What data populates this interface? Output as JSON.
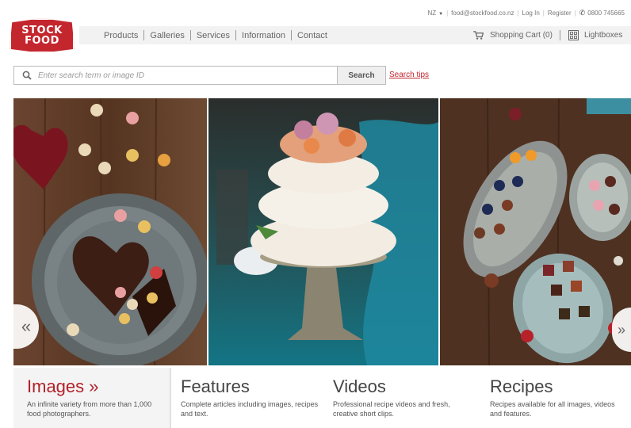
{
  "utility": {
    "country": "NZ",
    "email": "food@stockfood.co.nz",
    "login": "Log In",
    "register": "Register",
    "phone": "0800 745665"
  },
  "logo": {
    "line1": "STOCK",
    "line2": "FOOD"
  },
  "nav": {
    "items": [
      "Products",
      "Galleries",
      "Services",
      "Information",
      "Contact"
    ],
    "cart": "Shopping Cart (0)",
    "lightboxes": "Lightboxes"
  },
  "search": {
    "placeholder": "Enter search term or image ID",
    "button": "Search",
    "tips": "Search tips"
  },
  "slider": {
    "prev": "«",
    "next": "»"
  },
  "features": [
    {
      "title": "Images »",
      "desc": "An infinite variety from more than 1,000 food photographers."
    },
    {
      "title": "Features",
      "desc": "Complete articles including images, recipes and text."
    },
    {
      "title": "Videos",
      "desc": "Professional recipe videos and fresh, creative short clips."
    },
    {
      "title": "Recipes",
      "desc": "Recipes available for all images, videos and features."
    }
  ],
  "colors": {
    "brand": "#c4262e",
    "navbar": "#f2f2f2"
  },
  "icons": {
    "cart": "shopping-cart-icon",
    "lightbox": "lightbox-grid-icon",
    "search": "search-icon",
    "phone": "phone-icon"
  }
}
